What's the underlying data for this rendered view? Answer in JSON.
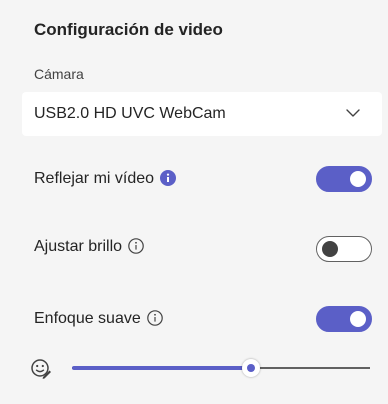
{
  "panel": {
    "title": "Configuración de video"
  },
  "camera": {
    "label": "Cámara",
    "selected": "USB2.0 HD UVC WebCam"
  },
  "mirror": {
    "label": "Reflejar mi vídeo",
    "enabled": true,
    "info_icon": "info-filled-icon"
  },
  "brightness": {
    "label": "Ajustar brillo",
    "enabled": false,
    "info_icon": "info-outline-icon"
  },
  "soft_focus": {
    "label": "Enfoque suave",
    "enabled": true,
    "info_icon": "info-outline-icon",
    "level_fraction": 0.6,
    "slider_icon": "emoji-edit-icon"
  },
  "colors": {
    "accent": "#5b5fc7",
    "background": "#f5f5f5",
    "text": "#242424"
  }
}
